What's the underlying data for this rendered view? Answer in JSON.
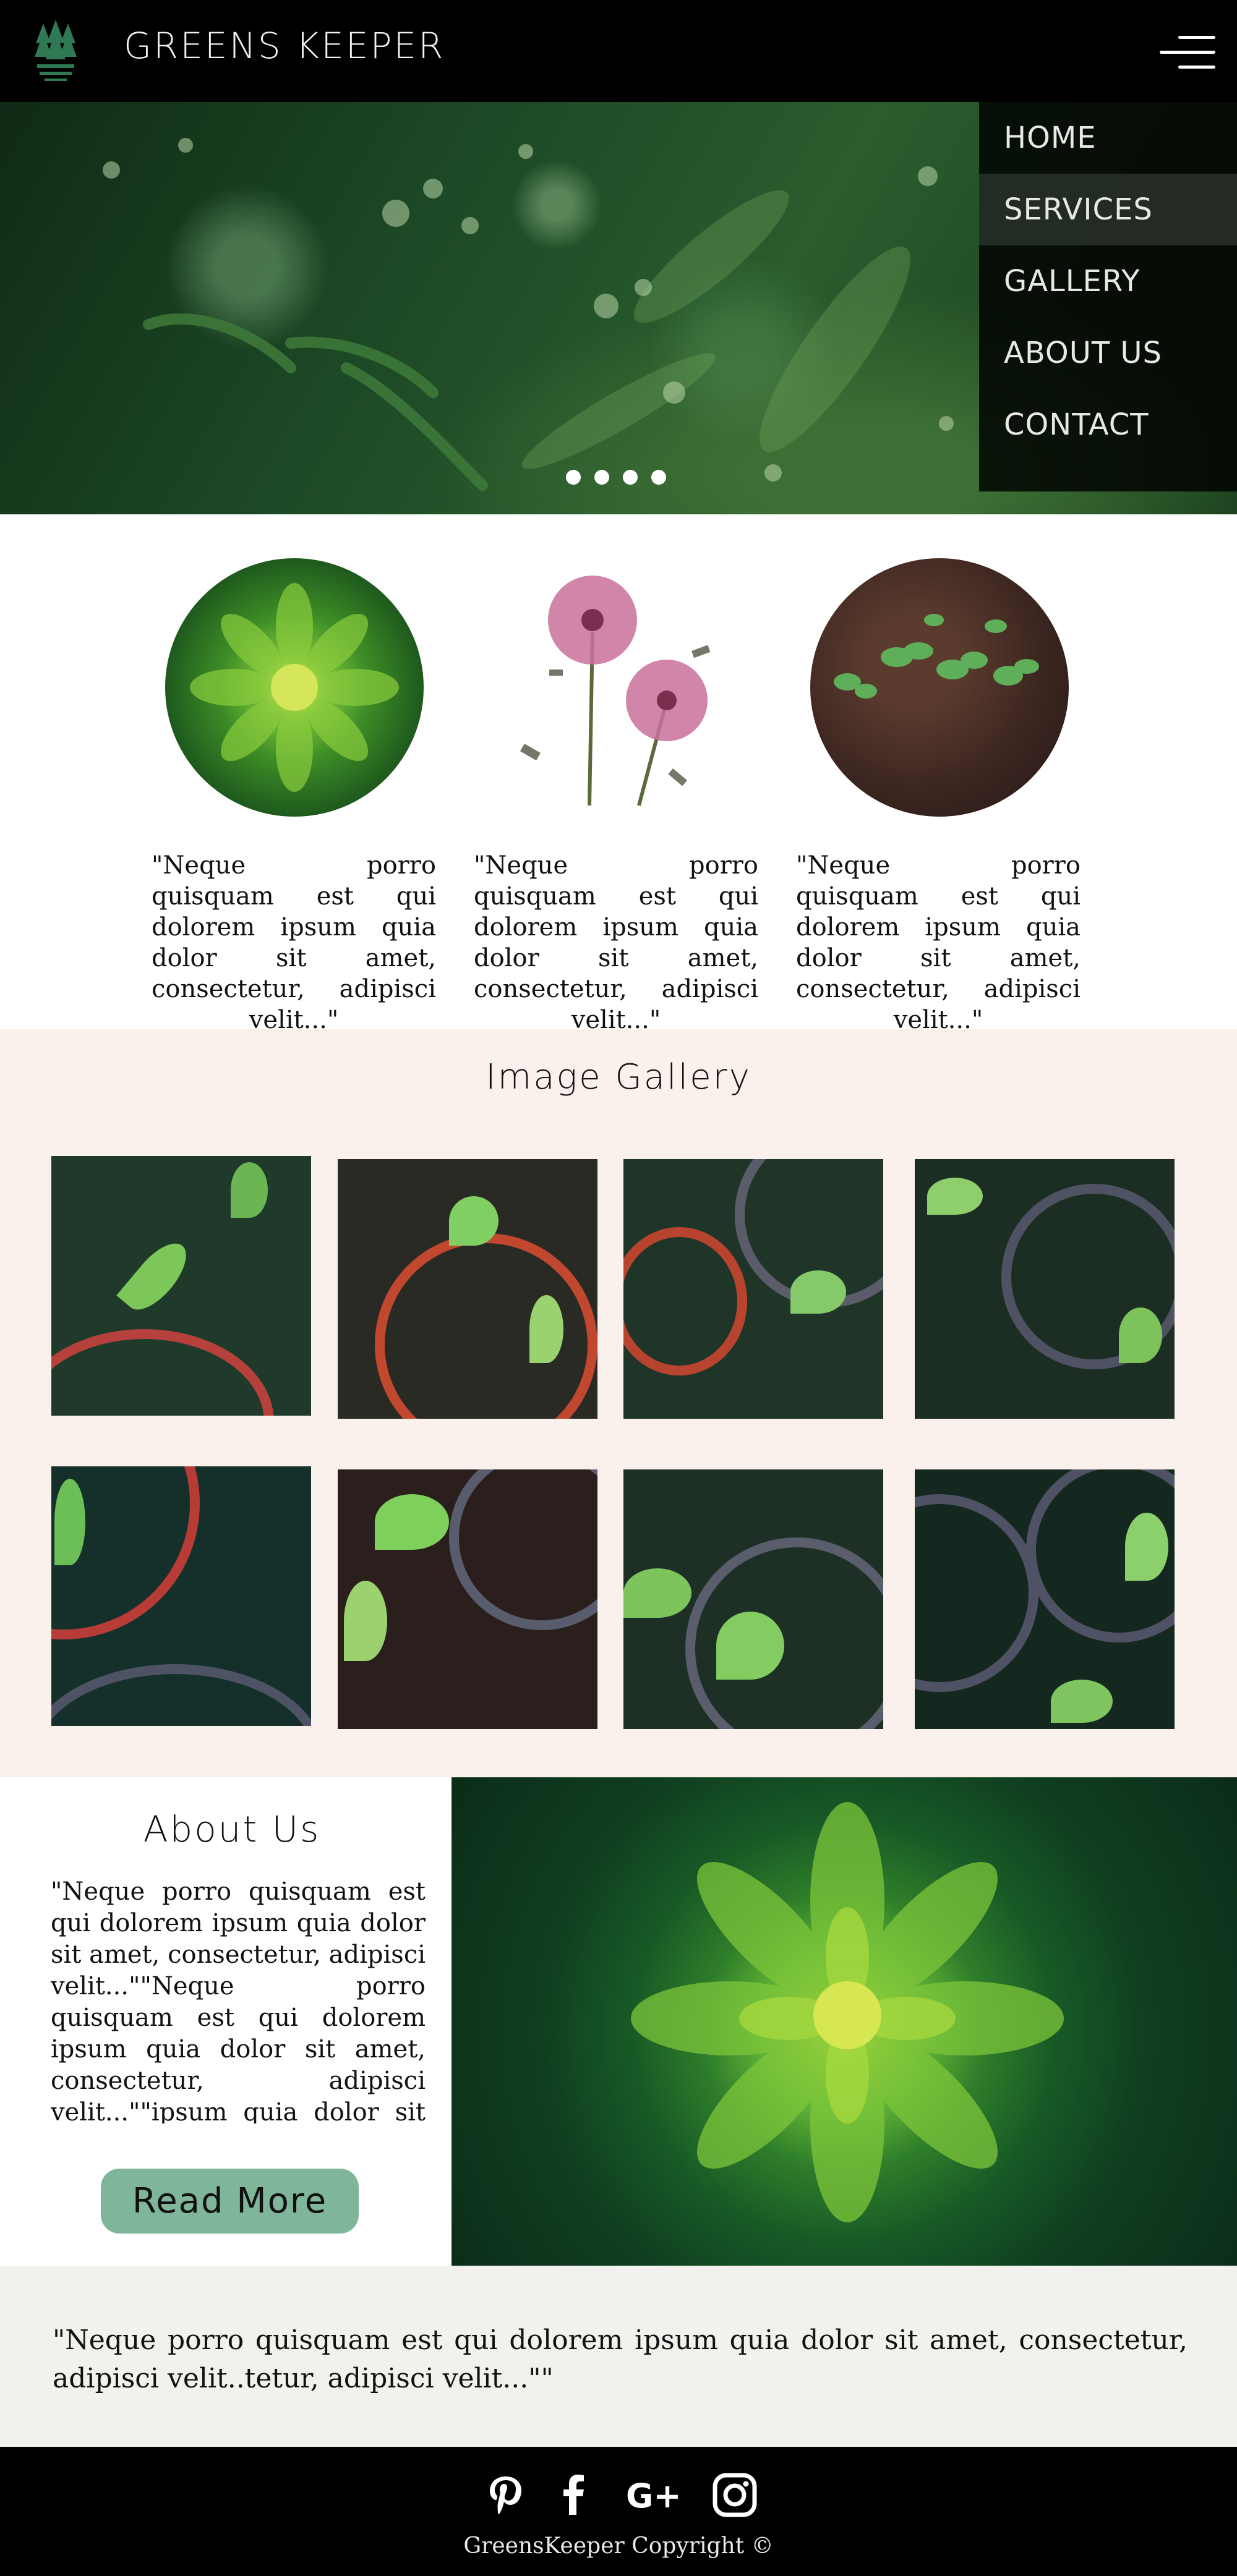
{
  "header": {
    "brand": "GREENS KEEPER",
    "logo_icon": "trees-logo-icon",
    "menu_icon": "hamburger-menu-icon"
  },
  "nav": {
    "items": [
      {
        "label": "HOME"
      },
      {
        "label": "SERVICES",
        "active": true
      },
      {
        "label": "GALLERY"
      },
      {
        "label": "ABOUT US"
      },
      {
        "label": "CONTACT"
      }
    ]
  },
  "hero": {
    "slide_count": 4
  },
  "features": [
    {
      "text": "\"Neque porro quisquam est qui dolorem ipsum quia dolor sit amet, consectetur, adipisci velit...\""
    },
    {
      "text": "\"Neque porro quisquam est qui dolorem ipsum quia dolor sit amet, consectetur, adipisci velit...\""
    },
    {
      "text": "\"Neque porro quisquam est qui dolorem ipsum quia dolor sit amet, consectetur, adipisci velit...\""
    }
  ],
  "gallery": {
    "title": "Image Gallery"
  },
  "about": {
    "title": "About Us",
    "body": "\"Neque porro quisquam est qui dolorem ipsum quia dolor sit amet, consectetur, adipisci velit...\"\"Neque porro quisquam est qui dolorem ipsum quia dolor sit amet, consectetur, adipisci velit...\"\"ipsum quia dolor sit amet, consectetur,",
    "button": "Read More"
  },
  "quote": {
    "text": "\"Neque porro quisquam est qui dolorem ipsum quia dolor sit amet, consectetur, adipisci velit..tetur, adipisci velit...\"\""
  },
  "footer": {
    "social": [
      "pinterest-icon",
      "facebook-icon",
      "google-plus-icon",
      "instagram-icon"
    ],
    "copyright": "GreensKeeper Copyright ©"
  },
  "colors": {
    "accent": "#7fb699",
    "gallery_bg": "#faf0ec",
    "quote_bg": "#f2f1ee",
    "header_bg": "#000000"
  }
}
